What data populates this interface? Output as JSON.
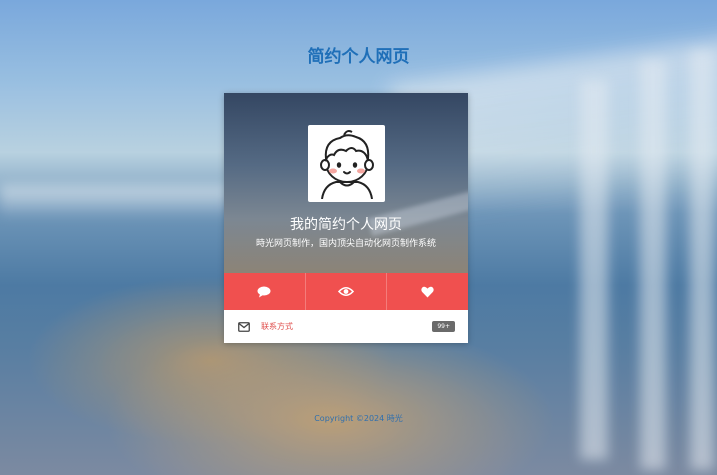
{
  "page": {
    "title": "简约个人网页",
    "footer": "Copyright ©2024 時光"
  },
  "card": {
    "title": "我的简约个人网页",
    "subtitle": "時光网页制作，国内顶尖自动化网页制作系统",
    "actions": [
      {
        "icon": "comment-icon"
      },
      {
        "icon": "eye-icon"
      },
      {
        "icon": "heart-icon"
      }
    ],
    "contact": {
      "icon": "mail-icon",
      "label": "联系方式",
      "badge": "99+"
    }
  },
  "colors": {
    "accent": "#f0504f",
    "title": "#1f6fb8",
    "footer": "#2f6fae",
    "badge": "#6a6a6a"
  }
}
